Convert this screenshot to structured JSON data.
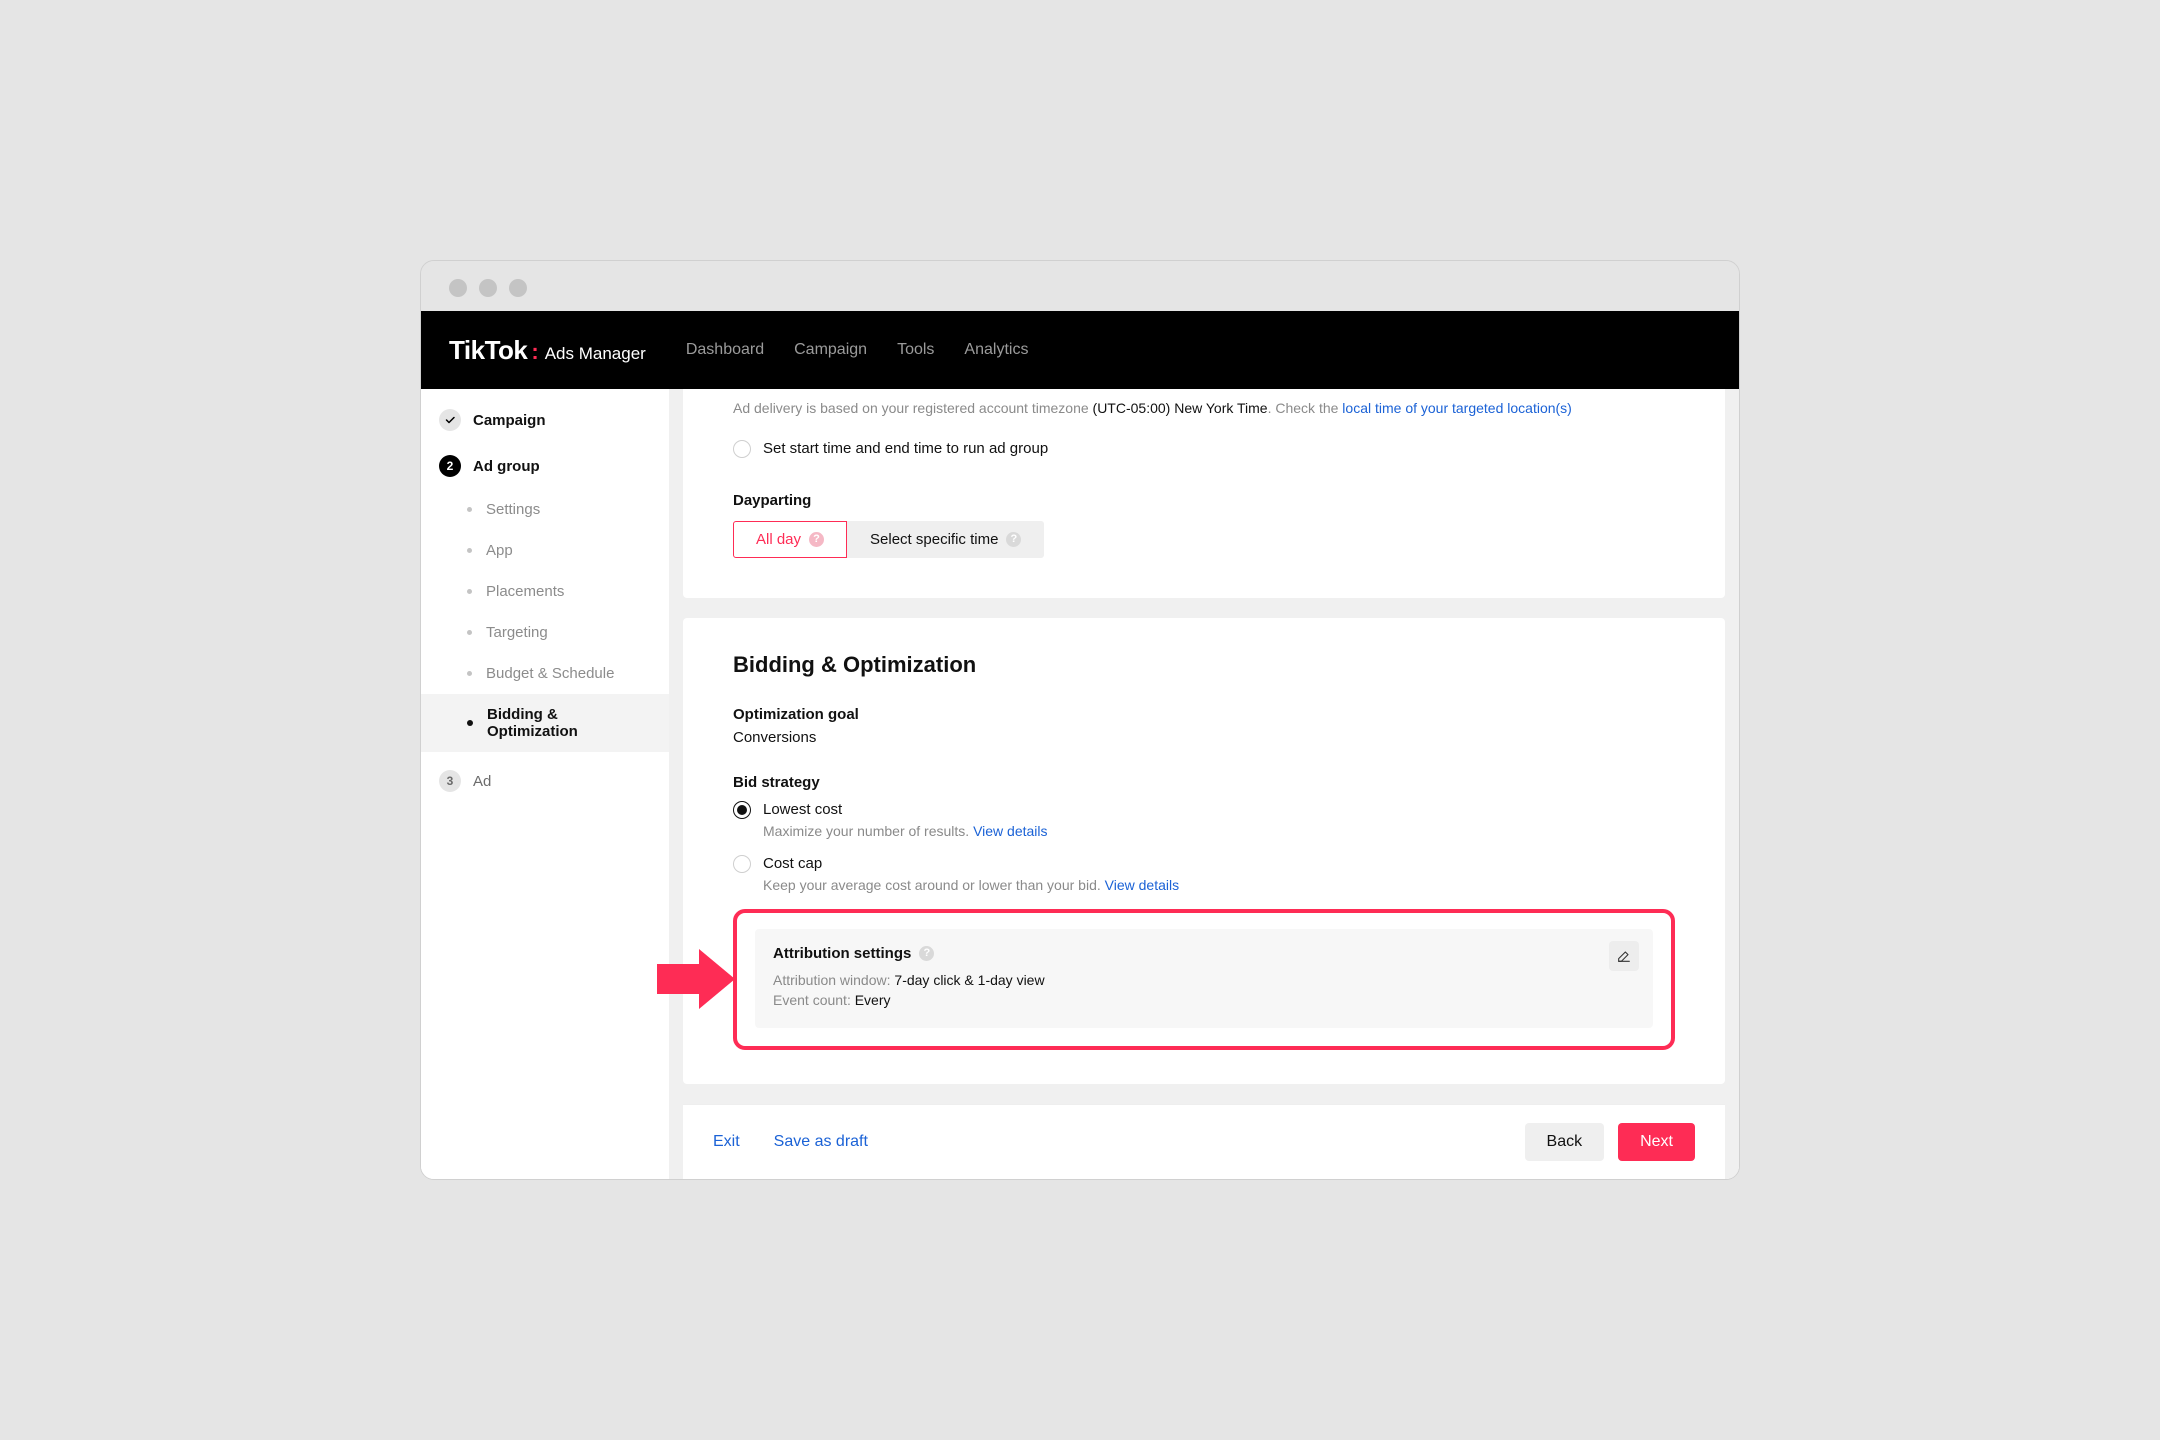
{
  "header": {
    "brand_main": "TikTok",
    "brand_sub": "Ads Manager",
    "nav": [
      "Dashboard",
      "Campaign",
      "Tools",
      "Analytics"
    ]
  },
  "sidebar": {
    "steps": [
      {
        "type": "check",
        "label": "Campaign"
      },
      {
        "type": "num",
        "num": "2",
        "label": "Ad group"
      }
    ],
    "subs": [
      "Settings",
      "App",
      "Placements",
      "Targeting",
      "Budget & Schedule",
      "Bidding & Optimization"
    ],
    "step3": {
      "num": "3",
      "label": "Ad"
    }
  },
  "schedule": {
    "note_prefix": "Ad delivery is based on your registered account timezone ",
    "timezone": "(UTC-05:00) New York Time",
    "note_mid": ". Check the ",
    "link": "local time of your targeted location(s)",
    "radio_schedule": "Set start time and end time to run ad group",
    "dayparting_label": "Dayparting",
    "allday": "All day",
    "specific": "Select specific time"
  },
  "bidding": {
    "title": "Bidding & Optimization",
    "opt_goal_label": "Optimization goal",
    "opt_goal_value": "Conversions",
    "bid_strategy_label": "Bid strategy",
    "lowest": "Lowest cost",
    "lowest_desc": "Maximize your number of results. ",
    "costcap": "Cost cap",
    "costcap_desc": "Keep your average cost around or lower than your bid. ",
    "view_details": "View details"
  },
  "attribution": {
    "title": "Attribution settings",
    "window_label": "Attribution window: ",
    "window_value": "7-day click & 1-day view",
    "event_label": "Event count: ",
    "event_value": "Every"
  },
  "footer": {
    "exit": "Exit",
    "save": "Save as draft",
    "back": "Back",
    "next": "Next"
  }
}
